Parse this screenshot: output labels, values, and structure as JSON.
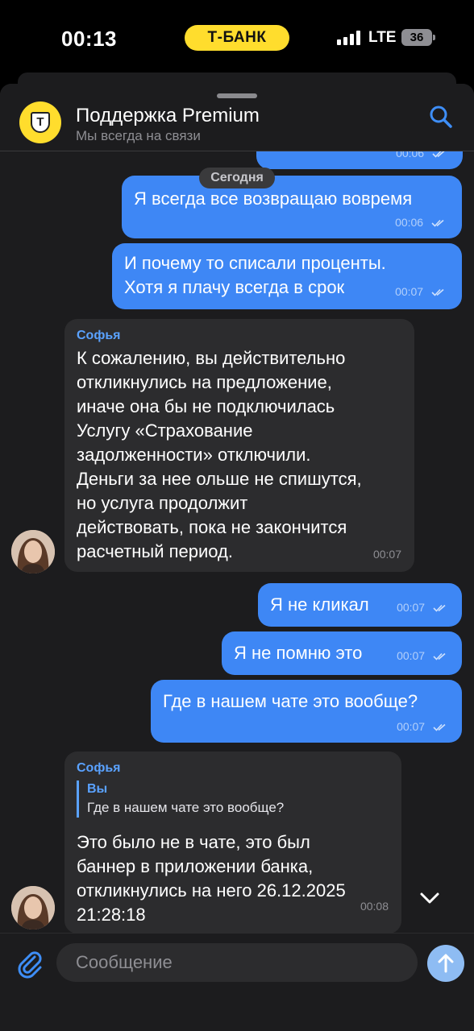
{
  "status_bar": {
    "time": "00:13",
    "brand": "Т-БАНК",
    "network": "LTE",
    "battery": "36"
  },
  "header": {
    "title": "Поддержка Premium",
    "subtitle": "Мы всегда на связи",
    "logo_letter": "Т"
  },
  "date_label": "Сегодня",
  "messages": [
    {
      "text": "Я не кликал",
      "time": "00:06"
    },
    {
      "text": "Я всегда все возвращаю вовремя",
      "time": "00:06"
    },
    {
      "text": "И почему то списали проценты.\nХотя я плачу всегда в срок",
      "time": "00:07"
    },
    {
      "sender": "Софья",
      "text": "К сожалению, вы действительно\nоткликнулись на предложение,\nиначе она бы не подключилась\nУслугу «Страхование\nзадолженности» отключили.\nДеньги за нее ольше не спишутся,\nно услуга продолжит\nдействовать, пока не закончится\nрасчетный период.",
      "time": "00:07"
    },
    {
      "text": "Я не кликал",
      "time": "00:07"
    },
    {
      "text": "Я не помню это",
      "time": "00:07"
    },
    {
      "text": "Где в нашем чате это вообще?",
      "time": "00:07"
    },
    {
      "sender": "Софья",
      "reply_name": "Вы",
      "reply_text": "Где в нашем чате это вообще?",
      "text": "Это было не в чате, это был\nбаннер в приложении банка,\nоткликнулись на него 26.12.2025\n21:28:18",
      "time": "00:08"
    }
  ],
  "composer": {
    "placeholder": "Сообщение"
  },
  "icons": [
    "search-icon",
    "checkmarks-icon",
    "chevron-down-icon",
    "paperclip-icon",
    "arrow-up-icon"
  ],
  "colors": {
    "brand_yellow": "#ffdd2d",
    "outgoing_bubble": "#3e87f5",
    "incoming_bubble": "#2c2c2e",
    "accent": "#5aa2ff",
    "background": "#1c1c1e"
  }
}
